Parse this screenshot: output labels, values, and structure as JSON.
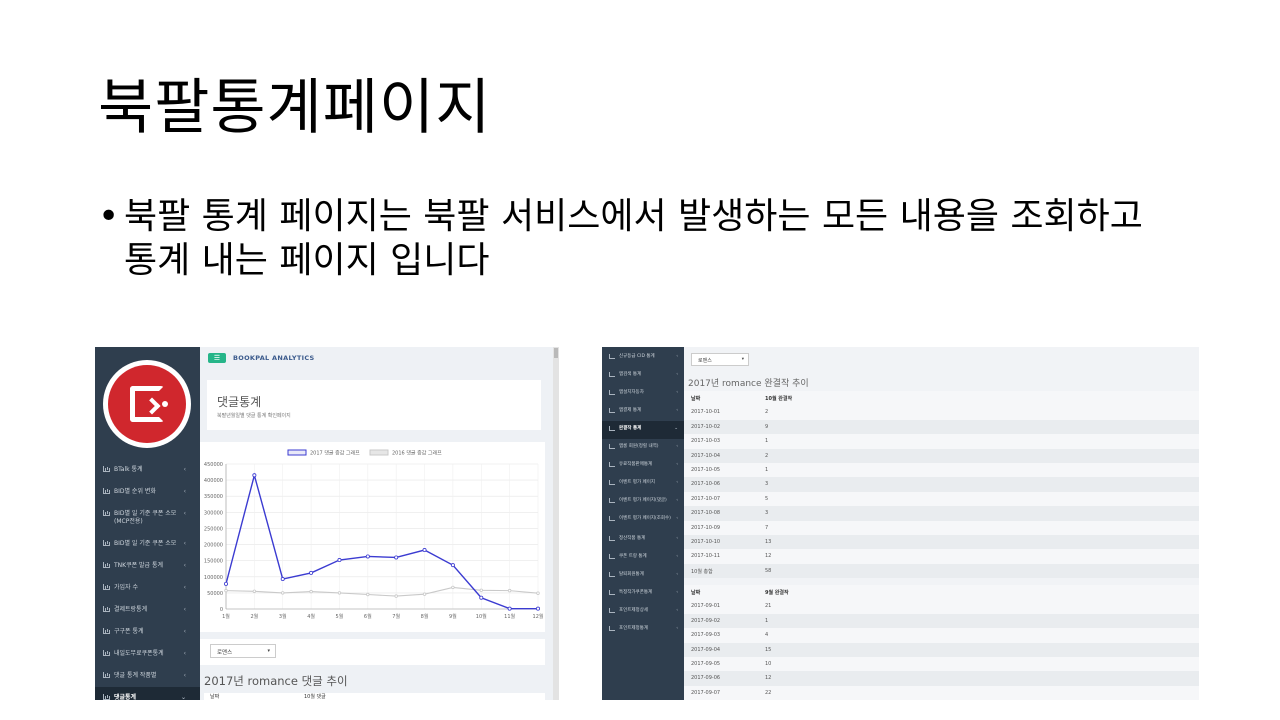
{
  "slide": {
    "title": "북팔통계페이지",
    "bullet_marker": "•",
    "bullet": "북팔 통계 페이지는 북팔 서비스에서 발생하는 모든 내용을 조회하고 통계 내는 페이지 입니다"
  },
  "left_screenshot": {
    "brand": "BOOKPAL ANALYTICS",
    "menu_icon": "☰",
    "sidebar": [
      {
        "label": "BTalk 통계",
        "arrow": "‹"
      },
      {
        "label": "BID별 순위 변화",
        "arrow": "‹"
      },
      {
        "label": "BID별 일 기준 쿠폰 소모 (MCP전용)",
        "arrow": "‹"
      },
      {
        "label": "BID별 일 기준 쿠폰 소모",
        "arrow": "‹"
      },
      {
        "label": "TNK쿠폰 발급 통계",
        "arrow": "‹"
      },
      {
        "label": "가입자 수",
        "arrow": "‹"
      },
      {
        "label": "결제트랑통계",
        "arrow": "‹"
      },
      {
        "label": "구구폰 통계",
        "arrow": "‹"
      },
      {
        "label": "내일도무료쿠폰통계",
        "arrow": "‹"
      },
      {
        "label": "댓글 통계 작품별",
        "arrow": "‹"
      },
      {
        "label": "댓글통계",
        "arrow": "⌄"
      }
    ],
    "panel_title": "댓글통계",
    "panel_subtitle": "북팔년월일별 댓글 통계 확인페이지",
    "select_value": "로맨스",
    "select_caret": "▾",
    "section_title": "2017년 romance 댓글 추이",
    "table_headers": [
      "날짜",
      "10월 댓글"
    ]
  },
  "chart_data": {
    "type": "line",
    "categories": [
      "1월",
      "2월",
      "3월",
      "4월",
      "5월",
      "6월",
      "7월",
      "8월",
      "9월",
      "10월",
      "11월",
      "12월"
    ],
    "series": [
      {
        "name": "2017 댓글 증감 그래프",
        "color": "#3b3bd1",
        "values": [
          78000,
          415000,
          93000,
          112000,
          152000,
          163000,
          160000,
          183000,
          136000,
          35000,
          1000,
          1000
        ]
      },
      {
        "name": "2016 댓글 증감 그래프",
        "color": "#c9c9c9",
        "values": [
          57000,
          55000,
          50000,
          54000,
          50000,
          45000,
          40000,
          46000,
          67000,
          58000,
          57000,
          49000
        ]
      }
    ],
    "yticks": [
      0,
      50000,
      100000,
      150000,
      200000,
      250000,
      300000,
      350000,
      400000,
      450000
    ],
    "ylim": [
      0,
      450000
    ],
    "grid": true,
    "legend_position": "top"
  },
  "right_screenshot": {
    "select_value": "로맨스",
    "select_caret": "▾",
    "section_title": "2017년 romance 완결작 추이",
    "sidebar": [
      {
        "label": "신규등급 CID 통계",
        "arrow": "‹"
      },
      {
        "label": "앱검색 통계",
        "arrow": "‹"
      },
      {
        "label": "앱설치자동차",
        "arrow": "‹"
      },
      {
        "label": "앱결제 통계",
        "arrow": "‹"
      },
      {
        "label": "완결작 통계",
        "arrow": "⌄"
      },
      {
        "label": "앱롱 회원(정렬 내역)",
        "arrow": "‹"
      },
      {
        "label": "유료작품판매통계",
        "arrow": "‹"
      },
      {
        "label": "이벤트 평가 페이지",
        "arrow": "‹"
      },
      {
        "label": "이벤트 평가 페이지(댓글)",
        "arrow": "‹"
      },
      {
        "label": "이벤트 평가 페이지(조회수)",
        "arrow": "‹"
      },
      {
        "label": "정산작품 통계",
        "arrow": "‹"
      },
      {
        "label": "쿠폰 트랑 통계",
        "arrow": "‹"
      },
      {
        "label": "탈퇴회원통계",
        "arrow": "‹"
      },
      {
        "label": "특정작가쿠폰통계",
        "arrow": "‹"
      },
      {
        "label": "포인트제정상세",
        "arrow": "‹"
      },
      {
        "label": "포인트제정통계",
        "arrow": "‹"
      }
    ],
    "table_oct": {
      "headers": [
        "날짜",
        "10월 완결작"
      ],
      "rows": [
        [
          "2017-10-01",
          "2"
        ],
        [
          "2017-10-02",
          "9"
        ],
        [
          "2017-10-03",
          "1"
        ],
        [
          "2017-10-04",
          "2"
        ],
        [
          "2017-10-05",
          "1"
        ],
        [
          "2017-10-06",
          "3"
        ],
        [
          "2017-10-07",
          "5"
        ],
        [
          "2017-10-08",
          "3"
        ],
        [
          "2017-10-09",
          "7"
        ],
        [
          "2017-10-10",
          "13"
        ],
        [
          "2017-10-11",
          "12"
        ],
        [
          "10월 총합",
          "58"
        ]
      ]
    },
    "table_sep": {
      "headers": [
        "날짜",
        "9월 완결작"
      ],
      "rows": [
        [
          "2017-09-01",
          "21"
        ],
        [
          "2017-09-02",
          "1"
        ],
        [
          "2017-09-03",
          "4"
        ],
        [
          "2017-09-04",
          "15"
        ],
        [
          "2017-09-05",
          "10"
        ],
        [
          "2017-09-06",
          "12"
        ],
        [
          "2017-09-07",
          "22"
        ]
      ]
    }
  }
}
